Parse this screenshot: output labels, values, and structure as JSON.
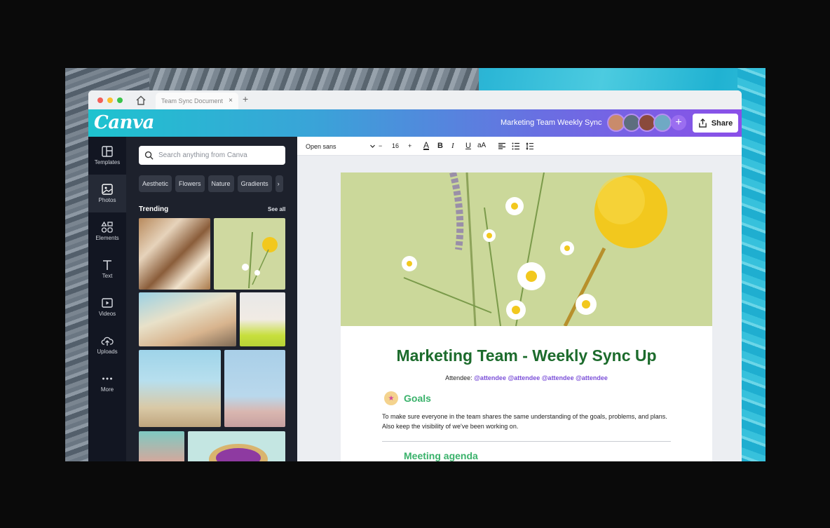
{
  "browser": {
    "tab_title": "Team Sync Document",
    "tab_close": "×",
    "new_tab": "+"
  },
  "header": {
    "logo": "Canva",
    "document_title": "Marketing Team Weekly Sync",
    "add_collaborator": "+",
    "share_label": "Share"
  },
  "nav": {
    "items": [
      {
        "label": "Templates",
        "icon": "templates-icon"
      },
      {
        "label": "Photos",
        "icon": "photos-icon"
      },
      {
        "label": "Elements",
        "icon": "elements-icon"
      },
      {
        "label": "Text",
        "icon": "text-icon"
      },
      {
        "label": "Videos",
        "icon": "videos-icon"
      },
      {
        "label": "Uploads",
        "icon": "uploads-icon"
      },
      {
        "label": "More",
        "icon": "more-icon"
      }
    ],
    "active": "Photos"
  },
  "panel": {
    "search_placeholder": "Search anything from Canva",
    "chips": [
      "Aesthetic",
      "Flowers",
      "Nature",
      "Gradients"
    ],
    "chips_next": "›",
    "section_title": "Trending",
    "see_all": "See all"
  },
  "toolbar": {
    "font": "Open sans",
    "minus": "−",
    "font_size": "16",
    "plus": "+",
    "text_color": "A",
    "bold": "B",
    "italic": "I",
    "underline": "U",
    "case": "aA"
  },
  "document": {
    "title": "Marketing Team - Weekly Sync Up",
    "attendee_label": "Attendee:",
    "attendees": [
      "@attendee",
      "@attendee",
      "@attendee",
      "@attendee"
    ],
    "goals_heading": "Goals",
    "goals_text": "To make sure everyone in the team shares the same understanding of the goals, problems, and plans. Also keep the visibility of we've been working on.",
    "agenda_heading": "Meeting agenda"
  },
  "colors": {
    "header_gradient_start": "#1ec3cf",
    "header_gradient_end": "#8b4fe8",
    "doc_title_green": "#1c6b2c",
    "section_green": "#3ab26b",
    "mention_purple": "#7b4fd8"
  }
}
